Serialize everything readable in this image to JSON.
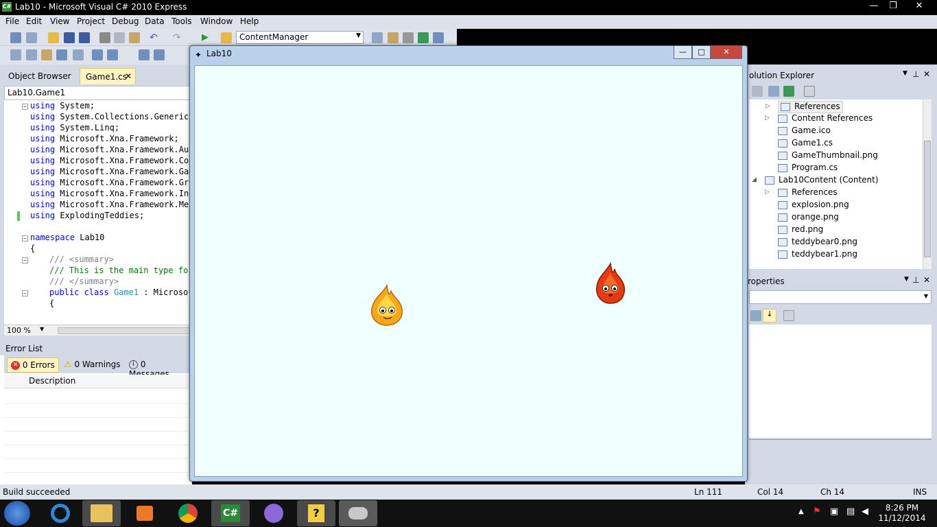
{
  "window": {
    "title": "Lab10 - Microsoft Visual C# 2010 Express",
    "app_icon": "C#"
  },
  "menu": [
    "File",
    "Edit",
    "View",
    "Project",
    "Debug",
    "Data",
    "Tools",
    "Window",
    "Help"
  ],
  "toolbar": {
    "config_value": "ContentManager"
  },
  "editor": {
    "tab_object_browser": "Object Browser",
    "tab_game1": "Game1.cs",
    "nav_class": "Lab10.Game1",
    "zoom": "100 %",
    "lines": [
      {
        "k": "using",
        "t": " System;"
      },
      {
        "k": "using",
        "t": " System.Collections.Generic;"
      },
      {
        "k": "using",
        "t": " System.Linq;"
      },
      {
        "k": "using",
        "t": " Microsoft.Xna.Framework;"
      },
      {
        "k": "using",
        "t": " Microsoft.Xna.Framework.Aud"
      },
      {
        "k": "using",
        "t": " Microsoft.Xna.Framework.Con"
      },
      {
        "k": "using",
        "t": " Microsoft.Xna.Framework.Gam"
      },
      {
        "k": "using",
        "t": " Microsoft.Xna.Framework.Gra"
      },
      {
        "k": "using",
        "t": " Microsoft.Xna.Framework.Inp"
      },
      {
        "k": "using",
        "t": " Microsoft.Xna.Framework.Med"
      },
      {
        "k": "using",
        "t": " ExplodingTeddies;"
      }
    ],
    "ns_kw": "namespace",
    "ns_name": " Lab10",
    "brace_open": "{",
    "sum1": "/// <summary>",
    "sum2": "/// This is the main type for",
    "sum3": "/// </summary>",
    "cls_kw": "public class",
    "cls_name": "Game1",
    "cls_rest": " : Microsof",
    "cls_brace": "{"
  },
  "error_list": {
    "title": "Error List",
    "errors": "0 Errors",
    "warnings": "0 Warnings",
    "messages": "0 Messages",
    "col_description": "Description"
  },
  "solution_explorer": {
    "title": "olution Explorer",
    "items": [
      {
        "label": "References",
        "indent": 1,
        "expander": "▷"
      },
      {
        "label": "Content References",
        "indent": 1,
        "expander": "▷"
      },
      {
        "label": "Game.ico",
        "indent": 1,
        "expander": ""
      },
      {
        "label": "Game1.cs",
        "indent": 1,
        "expander": ""
      },
      {
        "label": "GameThumbnail.png",
        "indent": 1,
        "expander": ""
      },
      {
        "label": "Program.cs",
        "indent": 1,
        "expander": ""
      },
      {
        "label": "Lab10Content (Content)",
        "indent": 0,
        "expander": "◢"
      },
      {
        "label": "References",
        "indent": 1,
        "expander": "▷"
      },
      {
        "label": "explosion.png",
        "indent": 1,
        "expander": ""
      },
      {
        "label": "orange.png",
        "indent": 1,
        "expander": ""
      },
      {
        "label": "red.png",
        "indent": 1,
        "expander": ""
      },
      {
        "label": "teddybear0.png",
        "indent": 1,
        "expander": ""
      },
      {
        "label": "teddybear1.png",
        "indent": 1,
        "expander": ""
      }
    ]
  },
  "properties": {
    "title": "roperties"
  },
  "game_window": {
    "title": "Lab10",
    "background": "#f0ffff"
  },
  "status": {
    "message": "Build succeeded",
    "ln": "Ln 111",
    "col": "Col 14",
    "ch": "Ch 14",
    "ins": "INS"
  },
  "taskbar": {
    "time": "8:26 PM",
    "date": "11/12/2014"
  }
}
